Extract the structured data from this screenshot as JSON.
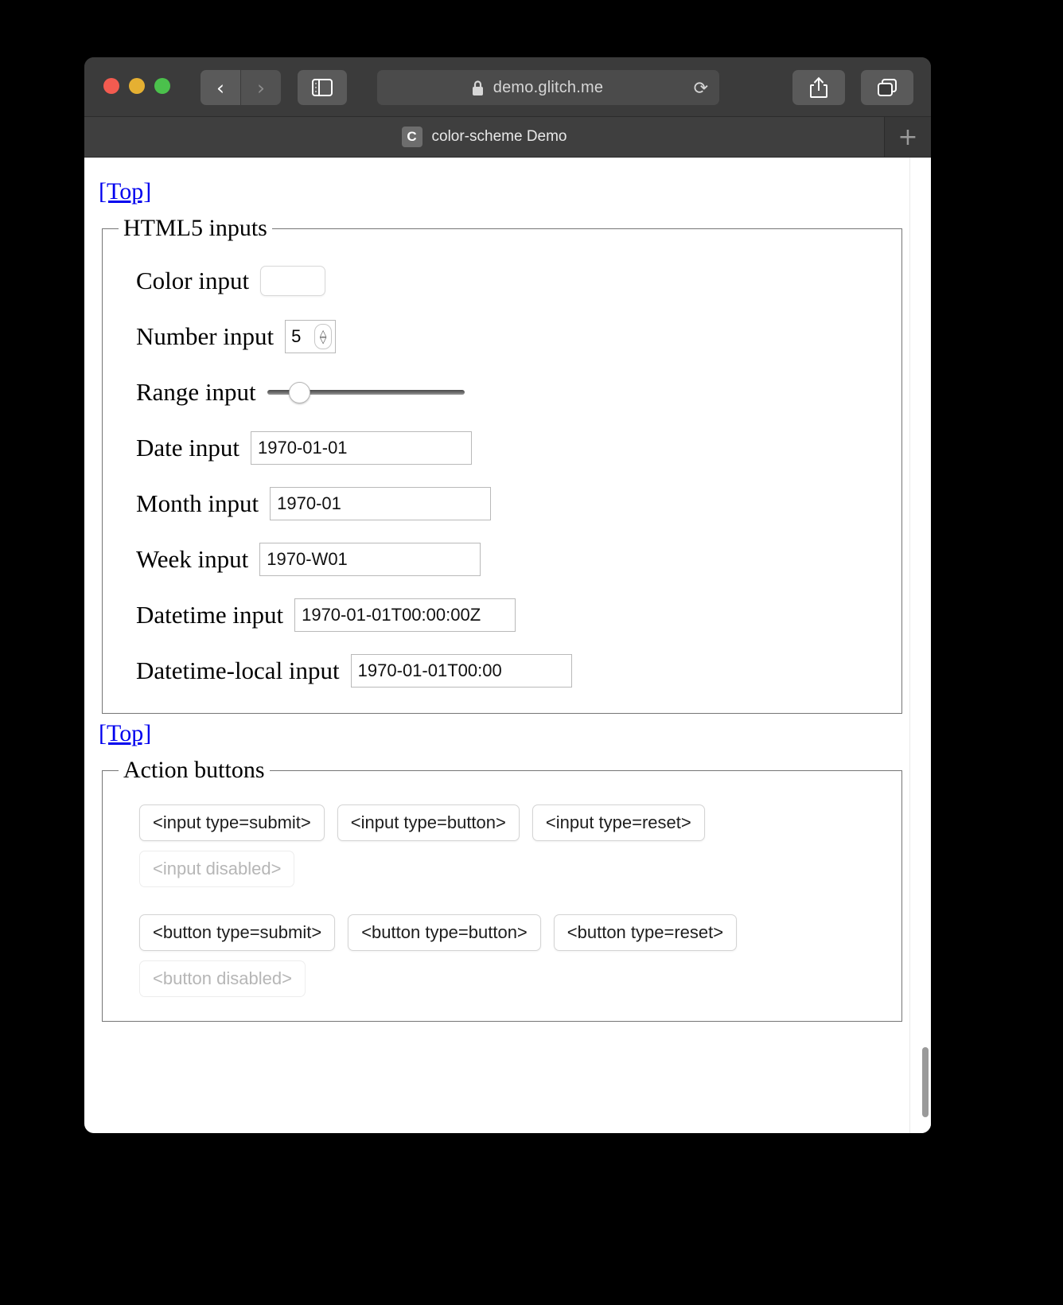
{
  "browser": {
    "window_controls": [
      "close",
      "minimize",
      "maximize"
    ],
    "back_glyph": "‹",
    "forward_glyph": "›",
    "sidebar_icon": "sidebar-icon",
    "reader_icon": "reader-icon",
    "lock_icon": "lock-icon",
    "url": "demo.glitch.me",
    "reload_glyph": "⟳",
    "share_icon": "share-icon",
    "tabs_icon": "tab-overview-icon",
    "new_tab_glyph": "+",
    "tab": {
      "favicon_letter": "C",
      "title": "color-scheme Demo"
    }
  },
  "page": {
    "top_link_1": "[Top]",
    "top_link_2": "[Top]",
    "html5_inputs": {
      "legend": "HTML5 inputs",
      "rows": [
        {
          "label": "Color input",
          "kind": "color",
          "value": "#000000"
        },
        {
          "label": "Number input",
          "kind": "number",
          "value": "5"
        },
        {
          "label": "Range input",
          "kind": "range",
          "value": "15"
        },
        {
          "label": "Date input",
          "kind": "text",
          "value": "1970-01-01"
        },
        {
          "label": "Month input",
          "kind": "text",
          "value": "1970-01"
        },
        {
          "label": "Week input",
          "kind": "text",
          "value": "1970-W01"
        },
        {
          "label": "Datetime input",
          "kind": "text",
          "value": "1970-01-01T00:00:00Z"
        },
        {
          "label": "Datetime-local input",
          "kind": "text",
          "value": "1970-01-01T00:00"
        }
      ]
    },
    "action_buttons": {
      "legend": "Action buttons",
      "input_row": [
        {
          "label": "<input type=submit>",
          "disabled": false
        },
        {
          "label": "<input type=button>",
          "disabled": false
        },
        {
          "label": "<input type=reset>",
          "disabled": false
        }
      ],
      "input_disabled": {
        "label": "<input disabled>",
        "disabled": true
      },
      "button_row": [
        {
          "label": "<button type=submit>",
          "disabled": false
        },
        {
          "label": "<button type=button>",
          "disabled": false
        },
        {
          "label": "<button type=reset>",
          "disabled": false
        }
      ],
      "button_disabled": {
        "label": "<button disabled>",
        "disabled": true
      }
    }
  },
  "colors": {
    "link": "#0000ee",
    "chrome": "#3b3b3b",
    "page_bg": "#ffffff",
    "color_swatch": "#000000"
  }
}
